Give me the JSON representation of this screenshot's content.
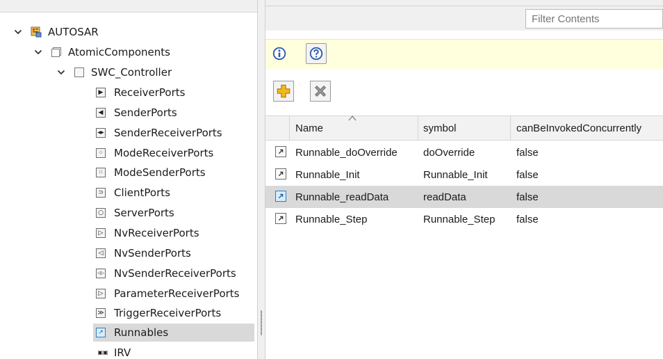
{
  "tree": {
    "root": {
      "label": "AUTOSAR",
      "icon": "autosar-package-icon"
    },
    "atomic": {
      "label": "AtomicComponents",
      "icon": "folder-icon"
    },
    "component": {
      "label": "SWC_Controller",
      "icon": "component-icon"
    },
    "items": [
      {
        "label": "ReceiverPorts",
        "icon": "receiver-port-icon",
        "glyph": "▶"
      },
      {
        "label": "SenderPorts",
        "icon": "sender-port-icon",
        "glyph": "◀"
      },
      {
        "label": "SenderReceiverPorts",
        "icon": "sender-receiver-port-icon",
        "glyph": "◀▶"
      },
      {
        "label": "ModeReceiverPorts",
        "icon": "mode-receiver-port-icon",
        "glyph": "⁘"
      },
      {
        "label": "ModeSenderPorts",
        "icon": "mode-sender-port-icon",
        "glyph": "⁙"
      },
      {
        "label": "ClientPorts",
        "icon": "client-port-icon",
        "glyph": "⊃"
      },
      {
        "label": "ServerPorts",
        "icon": "server-port-icon",
        "glyph": "○"
      },
      {
        "label": "NvReceiverPorts",
        "icon": "nv-receiver-port-icon",
        "glyph": "▷"
      },
      {
        "label": "NvSenderPorts",
        "icon": "nv-sender-port-icon",
        "glyph": "◁"
      },
      {
        "label": "NvSenderReceiverPorts",
        "icon": "nv-sender-receiver-port-icon",
        "glyph": "◁▷"
      },
      {
        "label": "ParameterReceiverPorts",
        "icon": "parameter-receiver-port-icon",
        "glyph": "▷"
      },
      {
        "label": "TriggerReceiverPorts",
        "icon": "trigger-receiver-port-icon",
        "glyph": "≫"
      },
      {
        "label": "Runnables",
        "icon": "runnable-icon",
        "glyph": "↗",
        "selected": true
      },
      {
        "label": "IRV",
        "icon": "irv-icon",
        "glyph": "▣▣"
      }
    ]
  },
  "filter": {
    "placeholder": "Filter Contents",
    "value": ""
  },
  "toolbar": {
    "info_icon": "info-icon",
    "help_icon": "help-icon",
    "add_icon": "add-icon",
    "delete_icon": "delete-icon"
  },
  "table": {
    "columns": [
      "Name",
      "symbol",
      "canBeInvokedConcurrently"
    ],
    "sorted_column": "Name",
    "rows": [
      {
        "name": "Runnable_doOverride",
        "symbol": "doOverride",
        "concurrent": "false"
      },
      {
        "name": "Runnable_Init",
        "symbol": "Runnable_Init",
        "concurrent": "false"
      },
      {
        "name": "Runnable_readData",
        "symbol": "readData",
        "concurrent": "false",
        "selected": true
      },
      {
        "name": "Runnable_Step",
        "symbol": "Runnable_Step",
        "concurrent": "false"
      }
    ]
  },
  "colors": {
    "selection": "#d9d9d9",
    "info_bar": "#ffffdd",
    "runnable_accent": "#2d7fc0",
    "add_icon": "#f2b81c",
    "delete_icon": "#8a8a8a"
  }
}
